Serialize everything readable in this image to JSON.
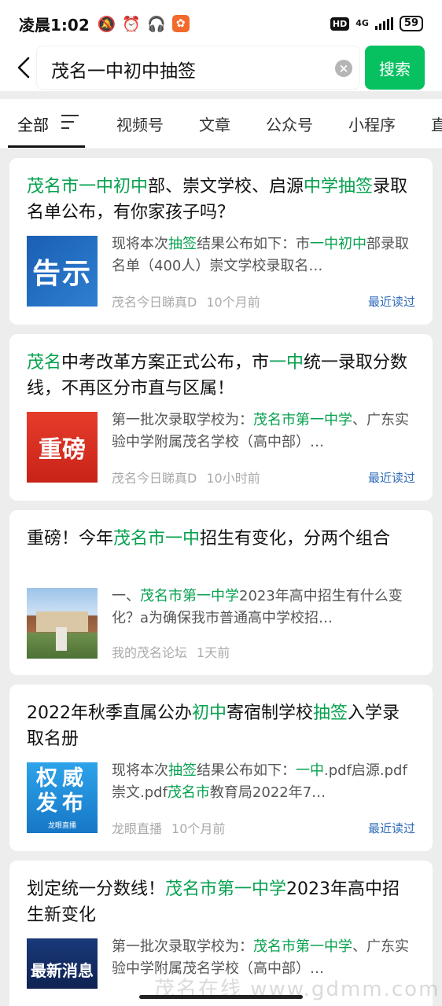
{
  "status_bar": {
    "time": "凌晨1:02",
    "icons": [
      "mute-bell-icon",
      "alarm-icon",
      "headphones-icon",
      "app-badge-icon"
    ],
    "hd": "HD",
    "network": "4G",
    "battery": "59"
  },
  "search": {
    "back_label": "‹",
    "query": "茂名一中初中抽签",
    "clear_label": "×",
    "button": "搜索"
  },
  "tabs": [
    {
      "label": "全部",
      "active": true
    },
    {
      "label": "视频号"
    },
    {
      "label": "文章"
    },
    {
      "label": "公众号"
    },
    {
      "label": "小程序"
    },
    {
      "label": "直"
    }
  ],
  "results": [
    {
      "title_segments": [
        {
          "text": "茂名市一中初中",
          "hl": true
        },
        {
          "text": "部、崇文学校、启源"
        },
        {
          "text": "中学抽签",
          "hl": true
        },
        {
          "text": "录取名单公布，有你家孩子吗？"
        }
      ],
      "thumb_text": "告示",
      "snippet_segments": [
        {
          "text": "现将本次"
        },
        {
          "text": "抽签",
          "hl": true
        },
        {
          "text": "结果公布如下：市"
        },
        {
          "text": "一中初中",
          "hl": true
        },
        {
          "text": "部录取名单（400人）崇文学校录取名…"
        }
      ],
      "source": "茂名今日睇真D",
      "time": "10个月前",
      "recent": "最近读过"
    },
    {
      "title_segments": [
        {
          "text": "茂名",
          "hl": true
        },
        {
          "text": "中考改革方案正式公布，市"
        },
        {
          "text": "一中",
          "hl": true
        },
        {
          "text": "统一录取分数线，不再区分市直与区属！"
        }
      ],
      "thumb_text": "重磅",
      "snippet_segments": [
        {
          "text": "第一批次录取学校为："
        },
        {
          "text": "茂名市第一中学",
          "hl": true
        },
        {
          "text": "、广东实验中学附属茂名学校（高中部）…"
        }
      ],
      "source": "茂名今日睇真D",
      "time": "10小时前",
      "recent": "最近读过"
    },
    {
      "title_segments": [
        {
          "text": "重磅！今年"
        },
        {
          "text": "茂名市一中",
          "hl": true
        },
        {
          "text": "招生有变化，分两个组合"
        }
      ],
      "thumb_text": "",
      "snippet_segments": [
        {
          "text": "一、"
        },
        {
          "text": "茂名市第一中学",
          "hl": true
        },
        {
          "text": "2023年高中招生有什么变化？a为确保我市普通高中学校招…"
        }
      ],
      "source": "我的茂名论坛",
      "time": "1天前",
      "recent": ""
    },
    {
      "title_segments": [
        {
          "text": "2022年秋季直属公办"
        },
        {
          "text": "初中",
          "hl": true
        },
        {
          "text": "寄宿制学校"
        },
        {
          "text": "抽签",
          "hl": true
        },
        {
          "text": "入学录取名册"
        }
      ],
      "thumb_text": "权威\n发布",
      "thumb_small": "龙眼直播",
      "snippet_segments": [
        {
          "text": "现将本次"
        },
        {
          "text": "抽签",
          "hl": true
        },
        {
          "text": "结果公布如下："
        },
        {
          "text": "一中",
          "hl": true
        },
        {
          "text": ".pdf启源.pdf崇文.pdf"
        },
        {
          "text": "茂名市",
          "hl": true
        },
        {
          "text": "教育局2022年7…"
        }
      ],
      "source": "龙眼直播",
      "time": "10个月前",
      "recent": "最近读过"
    },
    {
      "title_segments": [
        {
          "text": "划定统一分数线！"
        },
        {
          "text": "茂名市第一中学",
          "hl": true
        },
        {
          "text": "2023年高中招生新变化"
        }
      ],
      "thumb_text": "最新消息",
      "snippet_segments": [
        {
          "text": "第一批次录取学校为："
        },
        {
          "text": "茂名市第一中学",
          "hl": true
        },
        {
          "text": "、广东实验中学附属茂名学校（高中部）…"
        }
      ],
      "source": "",
      "time": "",
      "recent": ""
    }
  ],
  "watermark": "茂名在线 www.gdmm.com"
}
